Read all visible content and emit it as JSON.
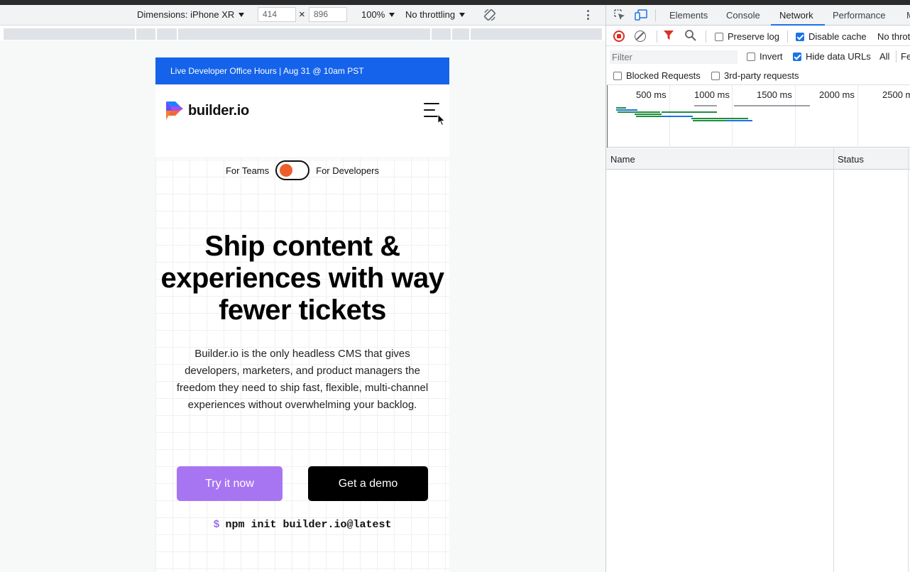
{
  "device_toolbar": {
    "dimensions_label": "Dimensions: iPhone XR",
    "width_value": "414",
    "times": "×",
    "height_value": "896",
    "zoom_label": "100%",
    "throttle_label": "No throttling",
    "rotate_icon": "rotate-icon",
    "more_icon": "kebab-icon"
  },
  "site": {
    "announcement": "Live Developer Office Hours | Aug 31 @ 10am PST",
    "logo_text": "builder.io",
    "toggle_left": "For Teams",
    "toggle_right": "For Developers",
    "hero_title": "Ship content & experiences with way fewer tickets",
    "hero_subtitle": "Builder.io is the only headless CMS that gives developers, marketers, and product managers the freedom they need to ship fast, flexible, multi-channel experiences without overwhelming your backlog.",
    "cta_primary": "Try it now",
    "cta_secondary": "Get a demo",
    "npm_prompt": "$",
    "npm_command": "npm init builder.io@latest",
    "colors": {
      "announcement_bg": "#1563ea",
      "primary_button": "#a875f2",
      "toggle_knob": "#ec5f2c"
    }
  },
  "devtools": {
    "tabs": [
      "Elements",
      "Console",
      "Network",
      "Performance",
      "M"
    ],
    "active_tab": "Network",
    "network_toolbar": {
      "preserve_log": "Preserve log",
      "disable_cache": "Disable cache",
      "disable_cache_checked": true,
      "throttle_truncated": "No throt"
    },
    "filter": {
      "placeholder": "Filter",
      "invert": "Invert",
      "hide_data_urls": "Hide data URLs",
      "hide_data_urls_checked": true,
      "all": "All",
      "fe": "Fe"
    },
    "blocked_requests": "Blocked Requests",
    "third_party": "3rd-party requests",
    "timeline_labels": [
      "500 ms",
      "1000 ms",
      "1500 ms",
      "2000 ms",
      "2500 m"
    ],
    "columns": [
      "Name",
      "Status"
    ]
  }
}
